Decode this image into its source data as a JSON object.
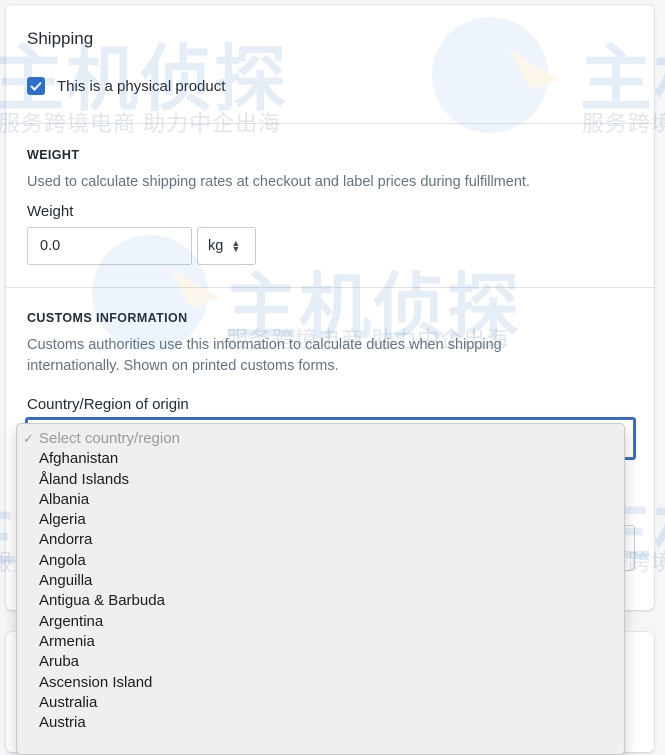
{
  "shipping": {
    "title": "Shipping",
    "physical_checkbox_label": "This is a physical product",
    "physical_checked": true
  },
  "weight": {
    "heading": "WEIGHT",
    "help": "Used to calculate shipping rates at checkout and label prices during fulfillment.",
    "label": "Weight",
    "value": "0.0",
    "unit": "kg"
  },
  "customs": {
    "heading": "CUSTOMS INFORMATION",
    "help_line1": "Customs authorities use this information to calculate duties when shipping",
    "help_line2": "internationally. Shown on printed customs forms.",
    "country_label": "Country/Region of origin"
  },
  "dropdown": {
    "placeholder": "Select country/region",
    "options": [
      "Afghanistan",
      "Åland Islands",
      "Albania",
      "Algeria",
      "Andorra",
      "Angola",
      "Anguilla",
      "Antigua & Barbuda",
      "Argentina",
      "Armenia",
      "Aruba",
      "Ascension Island",
      "Australia",
      "Austria"
    ]
  },
  "watermark": {
    "brand": "主机侦探",
    "tagline": "服务跨境电商 助力中企出海"
  },
  "colors": {
    "accent": "#2c6ecb",
    "focus_border": "#2c6ecb"
  },
  "icons": {
    "checkbox": "checkmark-icon",
    "unit_select": "up-down-arrows-icon",
    "selected_option": "checkmark-icon"
  }
}
